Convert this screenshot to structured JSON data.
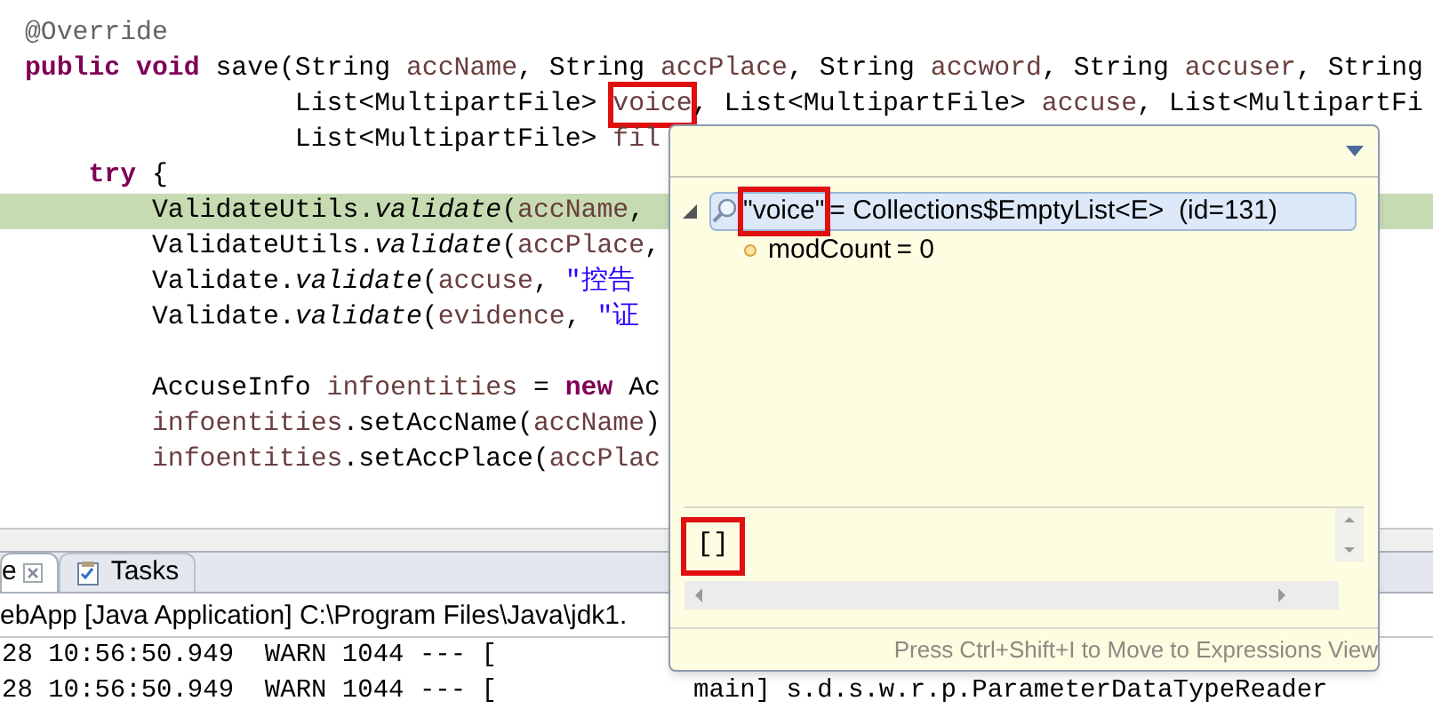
{
  "editor": {
    "lines": [
      {
        "current": false,
        "tokens": [
          {
            "text": "@Override",
            "kind": "annotation"
          }
        ]
      },
      {
        "current": false,
        "tokens": [
          {
            "text": "public",
            "kind": "keyword"
          },
          {
            "text": " void",
            "kind": "keyword"
          },
          {
            "text": " save(String ",
            "kind": "plain"
          },
          {
            "text": "accName",
            "kind": "param"
          },
          {
            "text": ", String ",
            "kind": "plain"
          },
          {
            "text": "accPlace",
            "kind": "param"
          },
          {
            "text": ", String ",
            "kind": "plain"
          },
          {
            "text": "accword",
            "kind": "param"
          },
          {
            "text": ", String ",
            "kind": "plain"
          },
          {
            "text": "accuser",
            "kind": "param"
          },
          {
            "text": ", String",
            "kind": "plain"
          }
        ]
      },
      {
        "current": false,
        "tokens": [
          {
            "text": "                 List<MultipartFile> ",
            "kind": "plain"
          },
          {
            "text": "voice",
            "kind": "param",
            "highlighted": true
          },
          {
            "text": ", List<MultipartFile> ",
            "kind": "plain"
          },
          {
            "text": "accuse",
            "kind": "param"
          },
          {
            "text": ", List<MultipartFi",
            "kind": "plain"
          }
        ]
      },
      {
        "current": false,
        "tokens": [
          {
            "text": "                 List<MultipartFile> ",
            "kind": "plain"
          },
          {
            "text": "fil",
            "kind": "param"
          }
        ]
      },
      {
        "current": false,
        "tokens": [
          {
            "text": "    try",
            "kind": "keyword"
          },
          {
            "text": " {",
            "kind": "plain"
          }
        ]
      },
      {
        "current": true,
        "tokens": [
          {
            "text": "        ValidateUtils.",
            "kind": "plain"
          },
          {
            "text": "validate",
            "kind": "static"
          },
          {
            "text": "(",
            "kind": "plain"
          },
          {
            "text": "accName",
            "kind": "param"
          },
          {
            "text": ",",
            "kind": "plain"
          }
        ]
      },
      {
        "current": false,
        "tokens": [
          {
            "text": "        ValidateUtils.",
            "kind": "plain"
          },
          {
            "text": "validate",
            "kind": "static"
          },
          {
            "text": "(",
            "kind": "plain"
          },
          {
            "text": "accPlace",
            "kind": "param"
          },
          {
            "text": ",",
            "kind": "plain"
          }
        ]
      },
      {
        "current": false,
        "tokens": [
          {
            "text": "        Validate.",
            "kind": "plain"
          },
          {
            "text": "validate",
            "kind": "static"
          },
          {
            "text": "(",
            "kind": "plain"
          },
          {
            "text": "accuse",
            "kind": "param"
          },
          {
            "text": ", ",
            "kind": "plain"
          },
          {
            "text": "\"控告",
            "kind": "string"
          }
        ]
      },
      {
        "current": false,
        "tokens": [
          {
            "text": "        Validate.",
            "kind": "plain"
          },
          {
            "text": "validate",
            "kind": "static"
          },
          {
            "text": "(",
            "kind": "plain"
          },
          {
            "text": "evidence",
            "kind": "param"
          },
          {
            "text": ", ",
            "kind": "plain"
          },
          {
            "text": "\"证",
            "kind": "string"
          }
        ]
      },
      {
        "current": false,
        "gap_before": true,
        "tokens": [
          {
            "text": "        AccuseInfo ",
            "kind": "plain"
          },
          {
            "text": "infoentities",
            "kind": "param"
          },
          {
            "text": " = ",
            "kind": "plain"
          },
          {
            "text": "new",
            "kind": "keyword"
          },
          {
            "text": " Ac",
            "kind": "plain"
          }
        ]
      },
      {
        "current": false,
        "tokens": [
          {
            "text": "        infoentities",
            "kind": "param"
          },
          {
            "text": ".setAccName(",
            "kind": "plain"
          },
          {
            "text": "accName",
            "kind": "param"
          },
          {
            "text": ")",
            "kind": "plain"
          }
        ]
      },
      {
        "current": false,
        "tokens": [
          {
            "text": "        infoentities",
            "kind": "param"
          },
          {
            "text": ".setAccPlace(",
            "kind": "plain"
          },
          {
            "text": "accPlac",
            "kind": "param"
          }
        ]
      }
    ]
  },
  "console_view": {
    "tabs": [
      {
        "label": "e",
        "selected": true,
        "closable": true
      },
      {
        "label": "Tasks",
        "selected": false,
        "closable": false
      }
    ],
    "launch_title": "ebApp [Java Application] C:\\Program Files\\Java\\jdk1.",
    "log_lines": [
      {
        "head": "28 10:56:50.949  WARN 1044 --- ["
      },
      {
        "head": "28 10:56:50.949  WARN 1044 --- [",
        "tail": "main] s.d.s.w.r.p.ParameterDataTypeReader"
      }
    ]
  },
  "debug_popup": {
    "variables": [
      {
        "name": "\"voice\"",
        "value": "= Collections$EmptyList<E>  (id=131)",
        "selected": true,
        "expanded": true,
        "highlighted": true,
        "kind": "root",
        "children": [
          {
            "name": "modCount",
            "value": "= 0",
            "selected": false,
            "highlighted": false,
            "kind": "field"
          }
        ]
      }
    ],
    "detail": {
      "text": "[]",
      "highlighted": true
    },
    "footer": "Press Ctrl+Shift+I to Move to Expressions View"
  }
}
